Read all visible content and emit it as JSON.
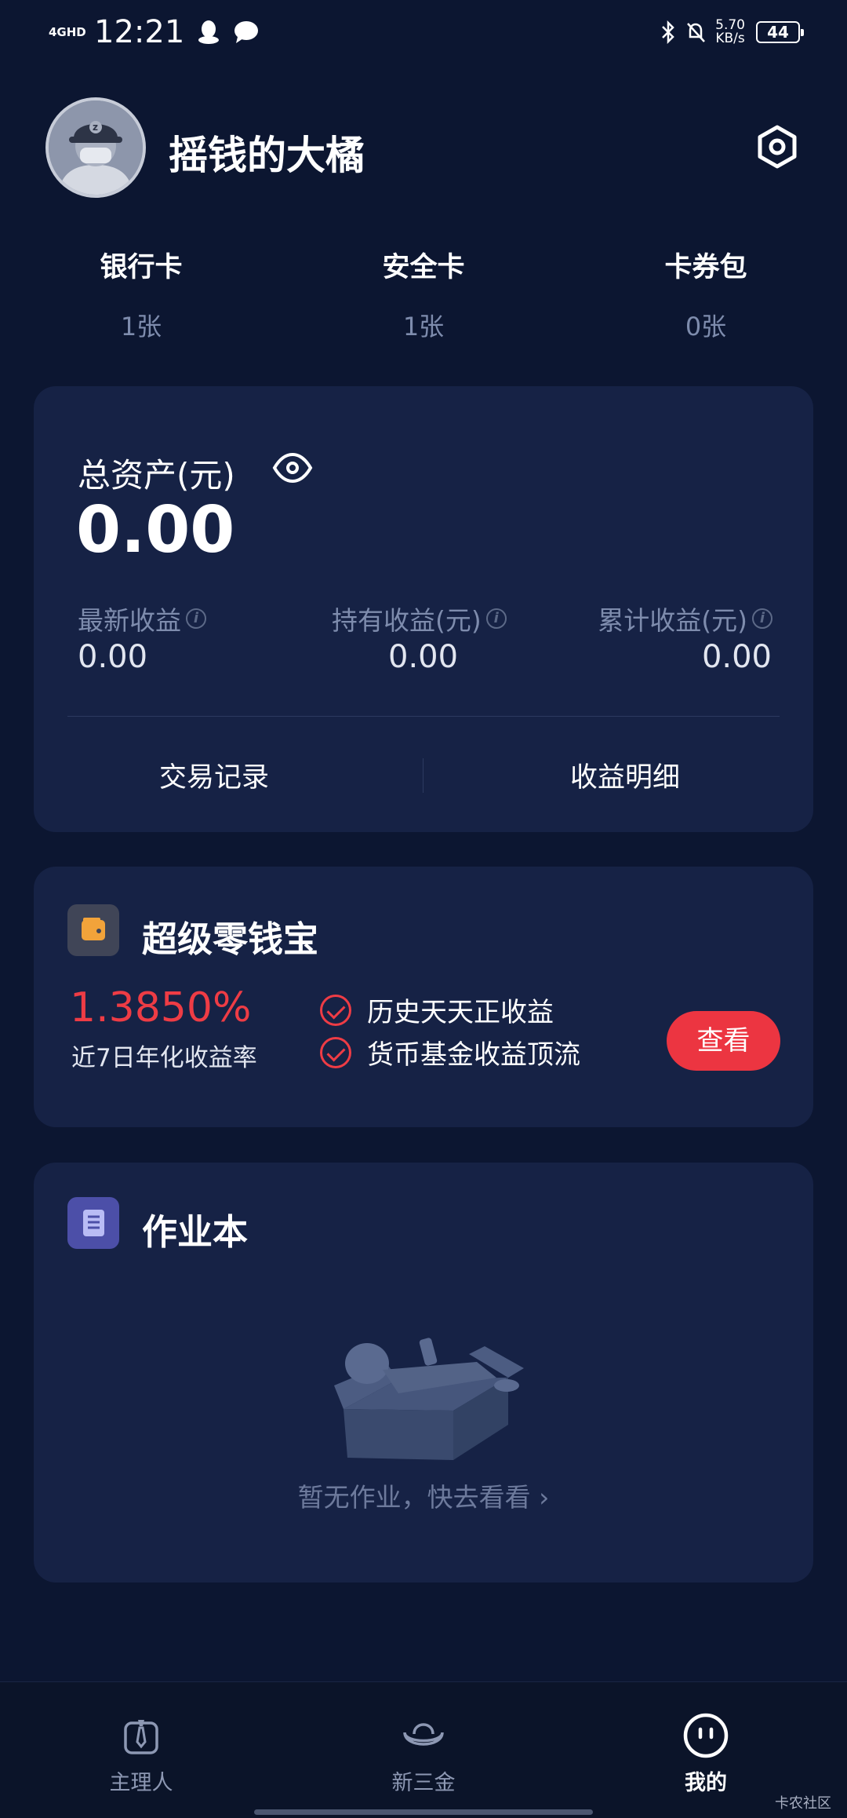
{
  "status_bar": {
    "network": "4GHD",
    "time": "12:21",
    "speed": "5.70",
    "speed_unit": "KB/s",
    "battery": "44"
  },
  "profile": {
    "username": "摇钱的大橘"
  },
  "stats": [
    {
      "title": "银行卡",
      "value": "1张"
    },
    {
      "title": "安全卡",
      "value": "1张"
    },
    {
      "title": "卡券包",
      "value": "0张"
    }
  ],
  "assets": {
    "title": "总资产(元)",
    "total": "0.00",
    "latest_label": "最新收益",
    "latest_value": "0.00",
    "holding_label": "持有收益(元)",
    "holding_value": "0.00",
    "cumulative_label": "累计收益(元)",
    "cumulative_value": "0.00",
    "info_glyph": "i",
    "trade_records": "交易记录",
    "income_details": "收益明细"
  },
  "zero_wallet": {
    "title": "超级零钱宝",
    "rate": "1.3850%",
    "rate_label": "近7日年化收益率",
    "feature_1": "历史天天正收益",
    "feature_2": "货币基金收益顶流",
    "button": "查看"
  },
  "homework": {
    "title": "作业本",
    "empty_text": "暂无作业，快去看看 ›"
  },
  "bottom_nav": [
    {
      "label": "主理人",
      "icon": "tie-icon"
    },
    {
      "label": "新三金",
      "icon": "gold-ingot-icon"
    },
    {
      "label": "我的",
      "icon": "smile-face-icon"
    }
  ],
  "watermark": "卡农社区",
  "colors": {
    "background": "#0c1631",
    "card": "#162245",
    "accent_red": "#ec3541"
  }
}
